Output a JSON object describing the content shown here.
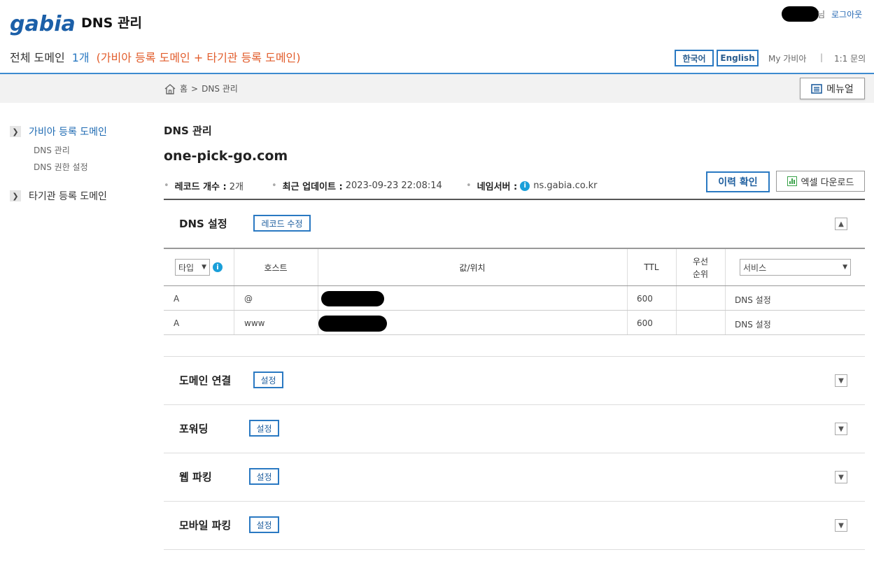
{
  "header": {
    "logo_text": "gabia.",
    "app_title": "DNS 관리",
    "user_suffix": "님",
    "logout": "로그아웃",
    "summary_label": "전체 도메인",
    "summary_count": "1개",
    "summary_note": "(가비아 등록 도메인 + 타기관 등록 도메인)",
    "lang_ko": "한국어",
    "lang_en": "English",
    "my_gabia": "My 가비아",
    "separator": "|",
    "inquiry": "1:1 문의"
  },
  "breadcrumb": {
    "home": "홈",
    "sep": ">",
    "current": "DNS 관리",
    "manual": "메뉴얼"
  },
  "sidebar": {
    "section1": "가비아 등록 도메인",
    "sub1": "DNS 관리",
    "sub2": "DNS 권한 설정",
    "section2": "타기관 등록 도메인"
  },
  "main": {
    "heading": "DNS 관리",
    "domain": "one-pick-go.com",
    "record_count_label": "레코드 개수 :",
    "record_count": "2개",
    "updated_label": "최근 업데이트 :",
    "updated": "2023-09-23 22:08:14",
    "ns_label": "네임서버 :",
    "ns": "ns.gabia.co.kr",
    "history_btn": "이력 확인",
    "excel_btn": "엑셀 다운로드"
  },
  "dns_section": {
    "title": "DNS 설정",
    "edit_btn": "레코드 수정",
    "columns": {
      "type_select": "타입",
      "host": "호스트",
      "value": "값/위치",
      "ttl": "TTL",
      "priority_line1": "우선",
      "priority_line2": "순위",
      "service_select": "서비스"
    },
    "rows": [
      {
        "type": "A",
        "host": "@",
        "ttl": "600",
        "priority": "",
        "service": "DNS 설정"
      },
      {
        "type": "A",
        "host": "www",
        "ttl": "600",
        "priority": "",
        "service": "DNS 설정"
      }
    ]
  },
  "sections": [
    {
      "title": "도메인 연결",
      "btn": "설정"
    },
    {
      "title": "포워딩",
      "btn": "설정"
    },
    {
      "title": "웹 파킹",
      "btn": "설정"
    },
    {
      "title": "모바일 파킹",
      "btn": "설정"
    }
  ],
  "colors": {
    "accent": "#2a79c2",
    "note": "#e25d2c",
    "header_line": "#3d8bd0"
  }
}
